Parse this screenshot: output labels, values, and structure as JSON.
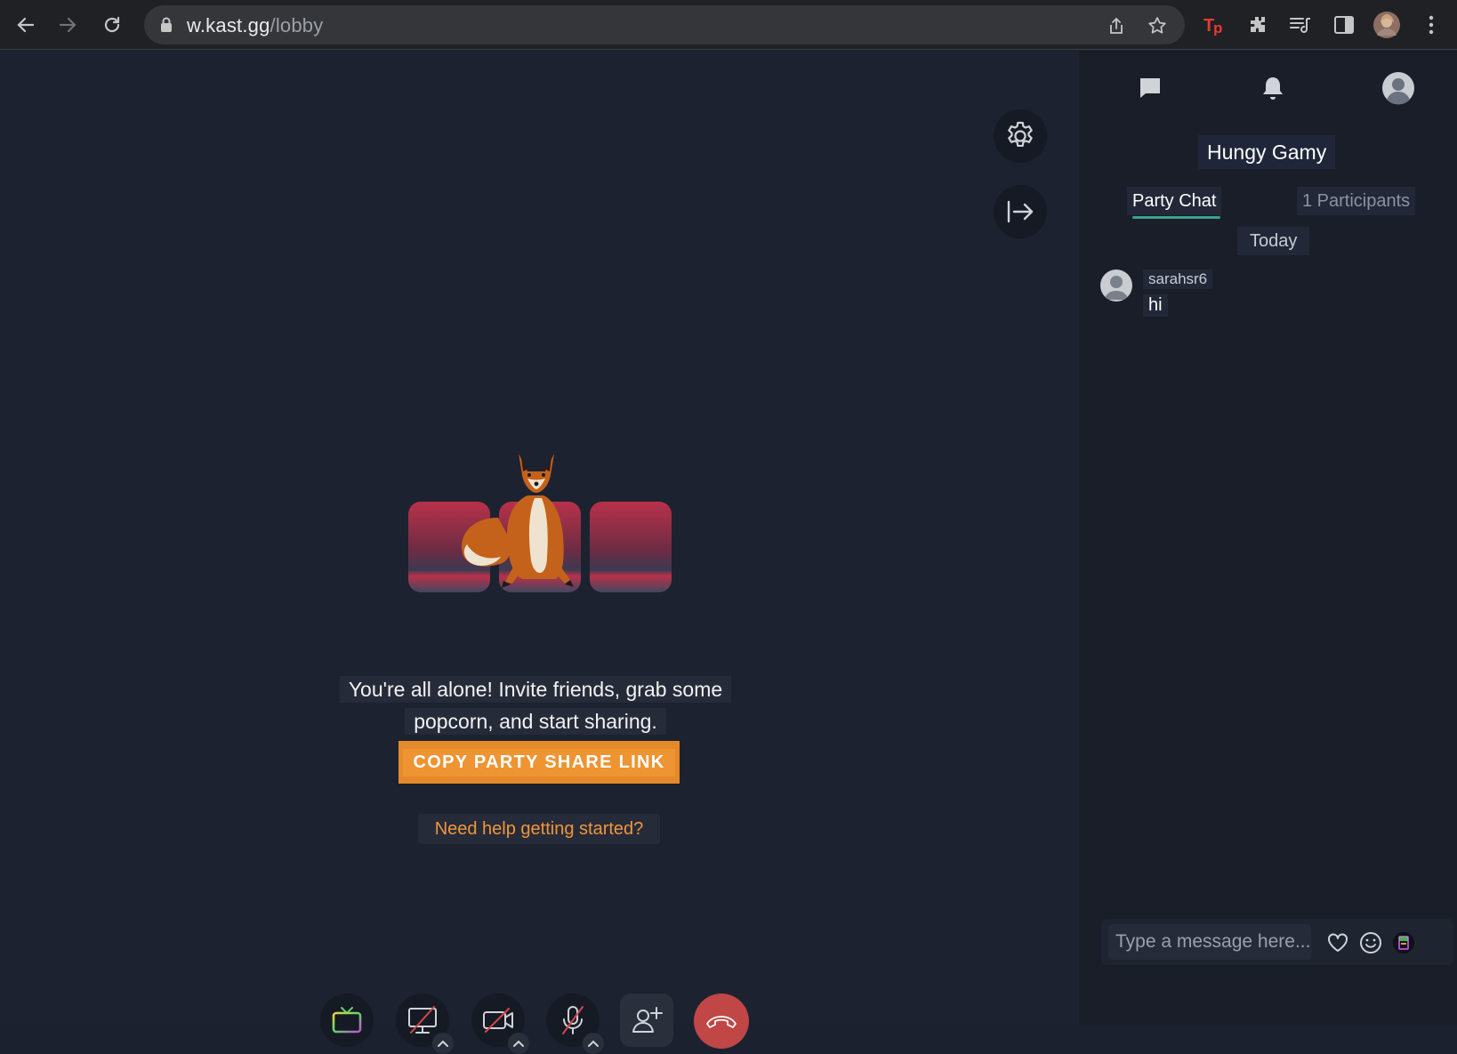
{
  "browser": {
    "url_host": "w.kast.gg",
    "url_path": "/lobby"
  },
  "stage": {
    "alone_line1": "You're all alone! Invite friends, grab some",
    "alone_line2": "popcorn, and start sharing.",
    "copy_button": "COPY PARTY SHARE LINK",
    "help_link": "Need help getting started?"
  },
  "sidebar": {
    "party_name": "Hungy Gamy",
    "tabs": [
      {
        "label": "Party Chat",
        "active": true
      },
      {
        "label": "1 Participants",
        "active": false
      }
    ],
    "date_divider": "Today",
    "messages": [
      {
        "user": "sarahsr6",
        "text": "hi"
      }
    ],
    "composer": {
      "placeholder": "Type a message here..."
    }
  },
  "colors": {
    "accent_orange": "#e58a2a",
    "tab_underline": "#3aa28c",
    "hangup_red": "#c14646",
    "stage_bg": "#1d2230",
    "sidebar_bg": "#1a1e29"
  },
  "icons": {
    "toolbar": [
      "tv-icon",
      "screen-share-off-icon",
      "camera-off-icon",
      "mic-off-icon",
      "add-user-icon",
      "hangup-icon"
    ],
    "sidebar_header": [
      "chat-icon",
      "bell-icon",
      "profile-icon"
    ],
    "stage_side": [
      "settings-gear-icon",
      "exit-panel-icon"
    ],
    "composer": [
      "heart-icon",
      "emoji-icon",
      "attachment-icon"
    ]
  }
}
